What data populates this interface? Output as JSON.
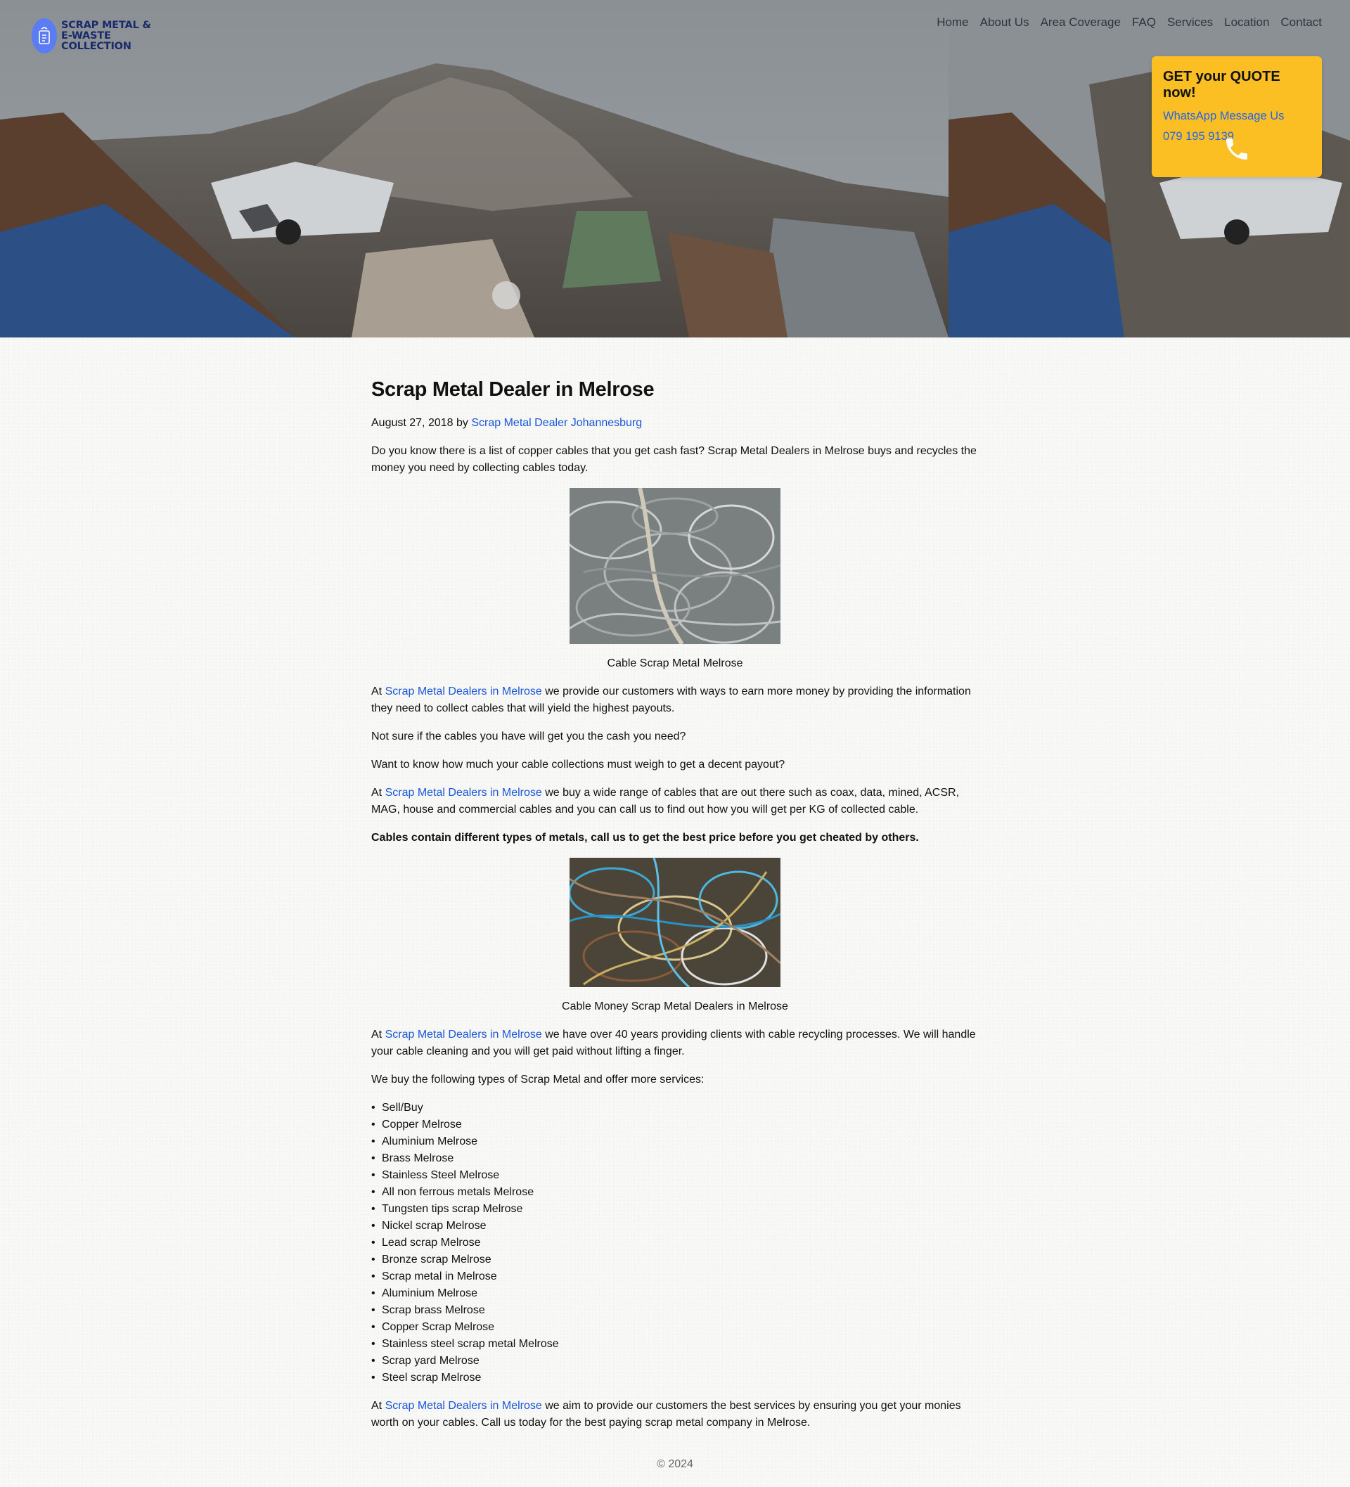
{
  "brand": {
    "logo_text": "SCRAP METAL & E-WASTE COLLECTION"
  },
  "nav": {
    "items": [
      "Home",
      "About Us",
      "Area Coverage",
      "FAQ",
      "Services",
      "Location",
      "Contact"
    ]
  },
  "quote_box": {
    "title": "GET your QUOTE now!",
    "whatsapp": "WhatsApp Message Us",
    "phone": "079 195 9139"
  },
  "article": {
    "title": "Scrap Metal Dealer in Melrose",
    "date": "August 27, 2018",
    "by": "by",
    "author": "Scrap Metal Dealer Johannesburg",
    "intro": "Do you know there is a list of copper cables that you get cash fast? Scrap Metal Dealers in Melrose buys and recycles the money you need by collecting cables today.",
    "caption1": "Cable Scrap Metal Melrose",
    "at": "At",
    "link": "Scrap Metal Dealers in Melrose",
    "p2_rest": "we provide our customers with ways to earn more money by providing the information they need to collect cables that will yield the highest payouts.",
    "p3": "Not sure if the cables you have will get you the cash you need?",
    "p4": "Want to know how much your cable collections must weigh to get a decent payout?",
    "p5_rest": "we buy a wide range of cables that are out there such as coax, data, mined, ACSR, MAG, house and commercial cables and you can call us to find out how you will get per KG of collected cable.",
    "p6_bold": "Cables contain different types of metals, call us to get the best price before you get cheated by others.",
    "caption2": "Cable Money Scrap Metal Dealers in Melrose",
    "p7_rest": "we have over 40 years providing clients with cable recycling processes. We will handle your cable cleaning and you will get paid without lifting a finger.",
    "p8": "We buy the following types of Scrap Metal and offer more services:",
    "services": [
      "Sell/Buy",
      "Copper Melrose",
      "Aluminium Melrose",
      "Brass Melrose",
      "Stainless Steel Melrose",
      "All non ferrous metals Melrose",
      "Tungsten tips scrap Melrose",
      "Nickel scrap Melrose",
      "Lead scrap Melrose",
      "Bronze scrap Melrose",
      "Scrap metal in Melrose",
      "Aluminium Melrose",
      "Scrap brass Melrose",
      "Copper Scrap Melrose",
      "Stainless steel scrap metal Melrose",
      "Scrap yard Melrose",
      "Steel scrap Melrose"
    ],
    "p9_rest": "we aim to provide our customers the best services by ensuring you get your monies worth on your cables. Call us today for the best paying scrap metal company in Melrose."
  },
  "footer": {
    "copyright": "© 2024"
  },
  "colors": {
    "quote_bg": "#fbbf24",
    "link": "#1a56db",
    "logo_badge": "#5b7cf5",
    "logo_text": "#1b2a6b"
  },
  "icons": [
    "recycle-icon",
    "phone-icon"
  ]
}
